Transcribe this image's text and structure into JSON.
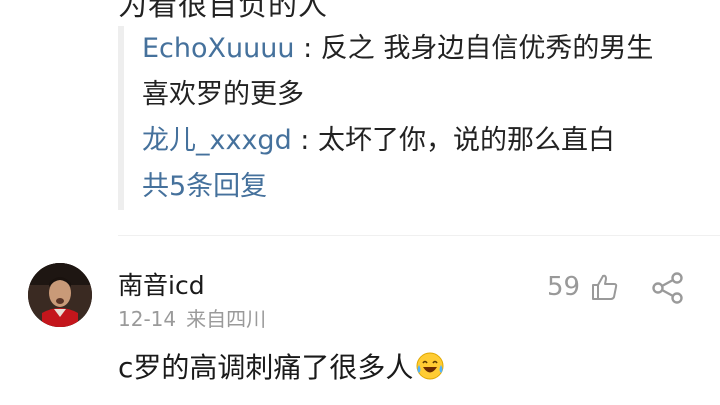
{
  "top_partial_text": "为看很自负的人",
  "replies": [
    {
      "author": "EchoXuuuu",
      "separator": " : ",
      "text_line1": "反之 我身边自信优秀的男生",
      "text_line2": "喜欢罗的更多"
    },
    {
      "author": "龙儿_xxxgd",
      "separator": " : ",
      "text_line1": "太坏了你，说的那么直白",
      "text_line2": ""
    }
  ],
  "more_replies_label": "共5条回复",
  "comment": {
    "username": "南音icd",
    "date": "12-14",
    "location": "来自四川",
    "like_count": "59",
    "text": "c罗的高调刺痛了很多人",
    "emoji": "laughing-crying-emoji"
  },
  "colors": {
    "link": "#45719c",
    "text": "#222222",
    "meta": "#9a9a9a",
    "quote_bar": "#eeeeee"
  }
}
